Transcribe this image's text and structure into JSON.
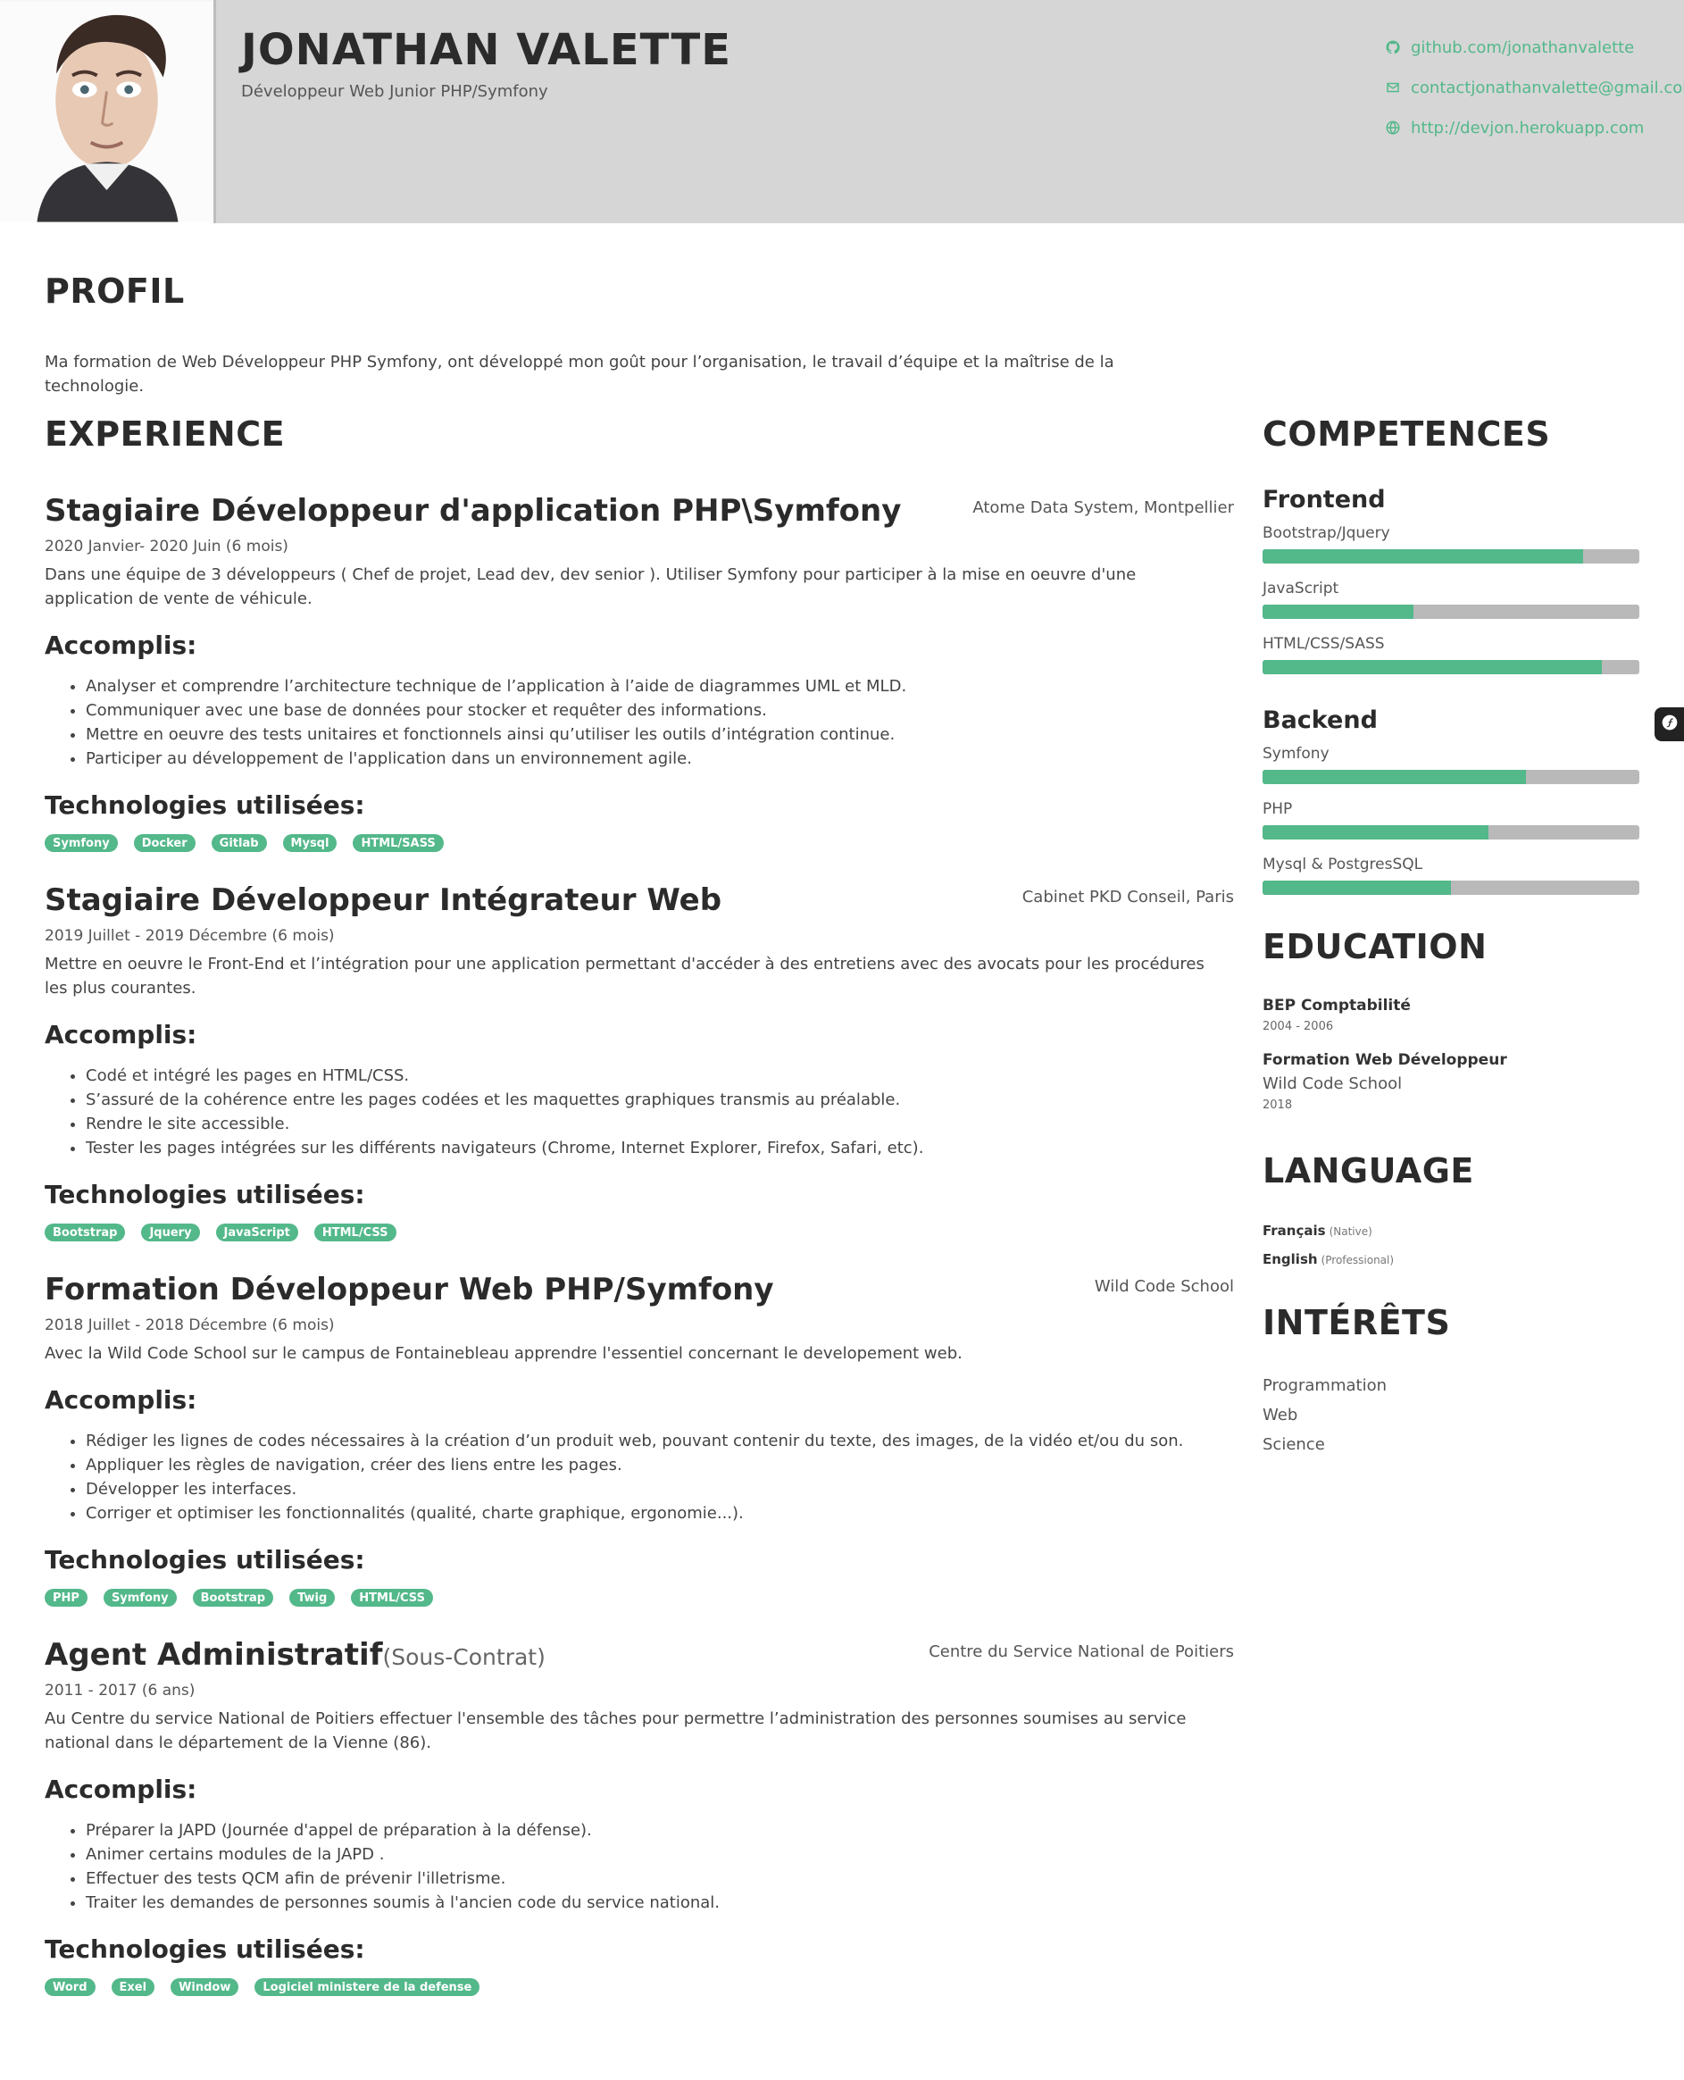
{
  "header": {
    "name": "JONATHAN VALETTE",
    "subtitle": "Développeur Web Junior PHP/Symfony",
    "contacts": [
      {
        "icon": "github-icon",
        "text": "github.com/jonathanvalette"
      },
      {
        "icon": "email-icon",
        "text": "contactjonathanvalette@gmail.com"
      },
      {
        "icon": "globe-icon",
        "text": "http://devjon.herokuapp.com"
      }
    ]
  },
  "profile": {
    "title": "PROFIL",
    "text": "Ma formation de Web Développeur PHP Symfony, ont développé mon goût pour l’organisation, le travail d’équipe et la maîtrise de la technologie."
  },
  "experience": {
    "title": "EXPERIENCE",
    "jobs": [
      {
        "title": "Stagiaire Développeur d'application PHP\\Symfony",
        "title_suffix": "",
        "company": "Atome Data System, Montpellier",
        "dates": "2020 Janvier- 2020 Juin (6 mois)",
        "description": "Dans une équipe de 3 développeurs ( Chef de projet, Lead dev, dev senior ). Utiliser Symfony pour participer à la mise en oeuvre d'une application de vente de véhicule.",
        "accomplis_title": "Accomplis:",
        "accomplis": [
          "Analyser et comprendre l’architecture technique de l’application à l’aide de diagrammes UML et MLD.",
          "Communiquer avec une base de données pour stocker et requêter des informations.",
          "Mettre en oeuvre des tests unitaires et fonctionnels ainsi qu’utiliser les outils d’intégration continue.",
          "Participer au développement de l'application dans un environnement agile."
        ],
        "tech_title": "Technologies utilisées:",
        "technologies": [
          "Symfony",
          "Docker",
          "Gitlab",
          "Mysql",
          "HTML/SASS"
        ]
      },
      {
        "title": "Stagiaire Développeur Intégrateur Web",
        "title_suffix": "",
        "company": "Cabinet PKD Conseil, Paris",
        "dates": "2019 Juillet - 2019 Décembre (6 mois)",
        "description": "Mettre en oeuvre le Front-End et l’intégration pour une application permettant d'accéder à des entretiens avec des avocats pour les procédures les plus courantes.",
        "accomplis_title": "Accomplis:",
        "accomplis": [
          "Codé et intégré les pages en HTML/CSS.",
          "S’assuré de la cohérence entre les pages codées et les maquettes graphiques transmis au préalable.",
          "Rendre le site accessible.",
          "Tester les pages intégrées sur les différents navigateurs (Chrome, Internet Explorer, Firefox, Safari, etc)."
        ],
        "tech_title": "Technologies utilisées:",
        "technologies": [
          "Bootstrap",
          "Jquery",
          "JavaScript",
          "HTML/CSS"
        ]
      },
      {
        "title": "Formation Développeur Web PHP/Symfony",
        "title_suffix": "",
        "company": "Wild Code School",
        "dates": "2018 Juillet - 2018 Décembre (6 mois)",
        "description": "Avec la Wild Code School sur le campus de Fontainebleau apprendre l'essentiel concernant le developement web.",
        "accomplis_title": "Accomplis:",
        "accomplis": [
          "Rédiger les lignes de codes nécessaires à la création d’un produit web, pouvant contenir du texte, des images, de la vidéo et/ou du son.",
          "Appliquer les règles de navigation, créer des liens entre les pages.",
          "Développer les interfaces.",
          "Corriger et optimiser les fonctionnalités (qualité, charte graphique, ergonomie...)."
        ],
        "tech_title": "Technologies utilisées:",
        "technologies": [
          "PHP",
          "Symfony",
          "Bootstrap",
          "Twig",
          "HTML/CSS"
        ]
      },
      {
        "title": "Agent Administratif",
        "title_suffix": "(Sous-Contrat)",
        "company": "Centre du Service National de Poitiers",
        "dates": "2011 - 2017 (6 ans)",
        "description": "Au Centre du service National de Poitiers effectuer l'ensemble des tâches pour permettre l’administration des personnes soumises au service national dans le département de la Vienne (86).",
        "accomplis_title": "Accomplis:",
        "accomplis": [
          "Préparer la JAPD (Journée d'appel de préparation à la défense).",
          "Animer certains modules de la JAPD .",
          "Effectuer des tests QCM afin de prévenir l'illetrisme.",
          "Traiter les demandes de personnes soumis à l'ancien code du service national."
        ],
        "tech_title": "Technologies utilisées:",
        "technologies": [
          "Word",
          "Exel",
          "Window",
          "Logiciel ministere de la defense"
        ]
      }
    ]
  },
  "competences": {
    "title": "COMPETENCES",
    "groups": [
      {
        "name": "Frontend",
        "skills": [
          {
            "label": "Bootstrap/Jquery",
            "value": 0.85
          },
          {
            "label": "JavaScript",
            "value": 0.4
          },
          {
            "label": "HTML/CSS/SASS",
            "value": 0.9
          }
        ]
      },
      {
        "name": "Backend",
        "skills": [
          {
            "label": "Symfony",
            "value": 0.7
          },
          {
            "label": "PHP",
            "value": 0.6
          },
          {
            "label": "Mysql & PostgresSQL",
            "value": 0.5
          }
        ]
      }
    ]
  },
  "education": {
    "title": "EDUCATION",
    "items": [
      {
        "title": "BEP Comptabilité",
        "school": "",
        "years": "2004 - 2006"
      },
      {
        "title": "Formation Web Développeur",
        "school": "Wild Code School",
        "years": "2018"
      }
    ]
  },
  "languages": {
    "title": "LANGUAGE",
    "items": [
      {
        "name": "Français",
        "level": "(Native)"
      },
      {
        "name": "English",
        "level": "(Professional)"
      }
    ]
  },
  "interests": {
    "title": "INTÉRÊTS",
    "items": [
      "Programmation",
      "Web",
      "Science"
    ]
  },
  "colors": {
    "accent": "#53b88a",
    "bar_bg": "#b9b9b9",
    "header_bg": "#d6d6d6"
  }
}
